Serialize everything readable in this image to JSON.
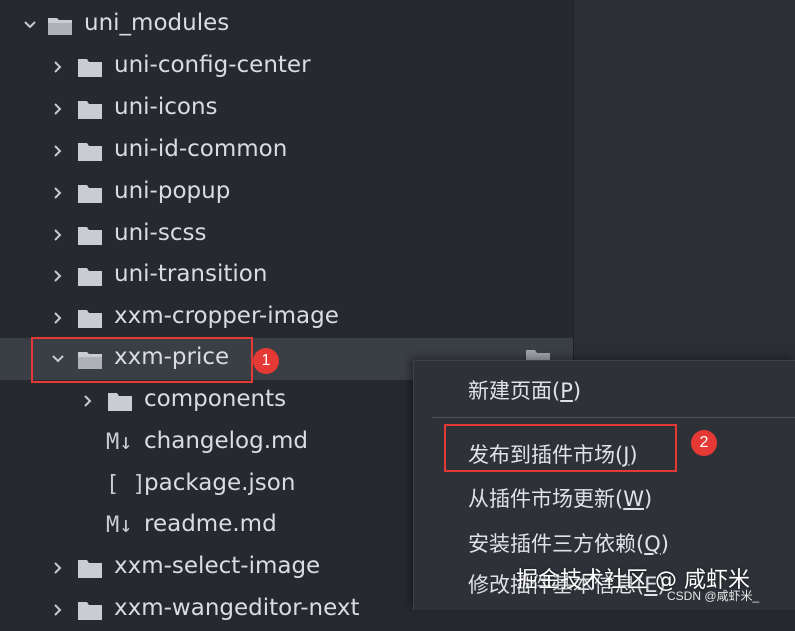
{
  "tree": {
    "root": "uni_modules",
    "items": [
      {
        "label": "uni-config-center",
        "type": "folder"
      },
      {
        "label": "uni-icons",
        "type": "folder"
      },
      {
        "label": "uni-id-common",
        "type": "folder"
      },
      {
        "label": "uni-popup",
        "type": "folder"
      },
      {
        "label": "uni-scss",
        "type": "folder"
      },
      {
        "label": "uni-transition",
        "type": "folder"
      },
      {
        "label": "xxm-cropper-image",
        "type": "folder"
      },
      {
        "label": "xxm-price",
        "type": "folder",
        "expanded": true,
        "selected": true
      },
      {
        "label": "components",
        "type": "folder"
      },
      {
        "label": "changelog.md",
        "type": "file",
        "glyph": "M↓"
      },
      {
        "label": "package.json",
        "type": "file",
        "glyph": "[ ]"
      },
      {
        "label": "readme.md",
        "type": "file",
        "glyph": "M↓"
      },
      {
        "label": "xxm-select-image",
        "type": "folder"
      },
      {
        "label": "xxm-wangeditor-next",
        "type": "folder"
      }
    ]
  },
  "badges": {
    "one": "1",
    "two": "2"
  },
  "context_menu": {
    "new_page": {
      "text": "新建页面(",
      "key": "P",
      "end": ")"
    },
    "publish": {
      "text": "发布到插件市场(",
      "key": "J",
      "end": ")"
    },
    "update": {
      "text": "从插件市场更新(",
      "key": "W",
      "end": ")"
    },
    "install": {
      "text": "安装插件三方依赖(",
      "key": "Q",
      "end": ")"
    },
    "modify": {
      "text": "修改插件基本信息(",
      "key": "E",
      "end": ")"
    }
  },
  "watermark": {
    "text": "掘金技术社区 @ 咸虾米",
    "csdn": "CSDN @咸虾米_"
  },
  "colors": {
    "accent_red": "#e53935",
    "background": "#26292e",
    "menu_bg": "#2e3238"
  }
}
